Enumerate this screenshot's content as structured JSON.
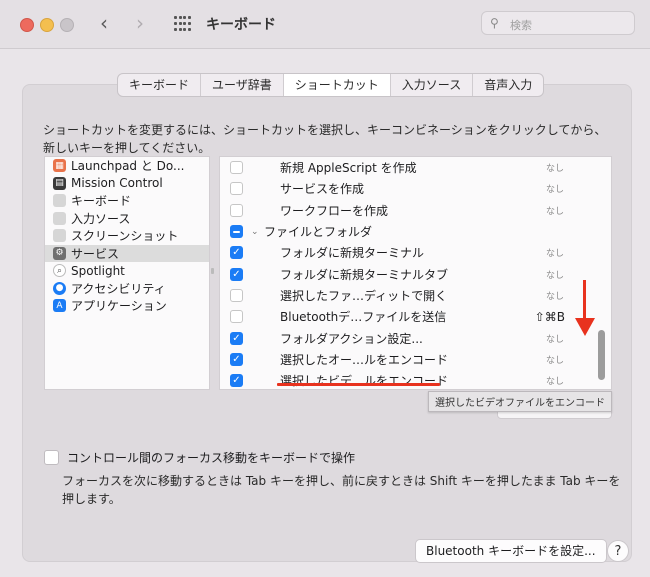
{
  "window": {
    "title": "キーボード",
    "search_placeholder": "検索"
  },
  "tabs": [
    {
      "label": "キーボード",
      "active": false
    },
    {
      "label": "ユーザ辞書",
      "active": false
    },
    {
      "label": "ショートカット",
      "active": true
    },
    {
      "label": "入力ソース",
      "active": false
    },
    {
      "label": "音声入力",
      "active": false
    }
  ],
  "instructions": "ショートカットを変更するには、ショートカットを選択し、キーコンビネーションをクリックしてから、新しいキーを押してください。",
  "categories": [
    {
      "label": "Launchpad と Do...",
      "icon": "launchpad-icon",
      "color": "#e9734b"
    },
    {
      "label": "Mission Control",
      "icon": "mission-control-icon",
      "color": "#3a3a3a"
    },
    {
      "label": "キーボード",
      "icon": "keyboard-icon",
      "color": "#d6d6d6"
    },
    {
      "label": "入力ソース",
      "icon": "input-source-icon",
      "color": "#d6d6d6"
    },
    {
      "label": "スクリーンショット",
      "icon": "screenshot-icon",
      "color": "#d6d6d6"
    },
    {
      "label": "サービス",
      "icon": "gear-icon",
      "color": "#6f6f6f",
      "selected": true
    },
    {
      "label": "Spotlight",
      "icon": "spotlight-icon",
      "color": "#ffffff"
    },
    {
      "label": "アクセシビリティ",
      "icon": "accessibility-icon",
      "color": "#1b7cf5"
    },
    {
      "label": "アプリケーション",
      "icon": "app-store-icon",
      "color": "#1b7cf5"
    }
  ],
  "shortcuts": [
    {
      "label": "新規 AppleScript を作成",
      "state": "off",
      "key": "なし"
    },
    {
      "label": "サービスを作成",
      "state": "off",
      "key": "なし"
    },
    {
      "label": "ワークフローを作成",
      "state": "off",
      "key": "なし"
    },
    {
      "label": "ファイルとフォルダ",
      "state": "mixed",
      "key": "",
      "group": true
    },
    {
      "label": "フォルダに新規ターミナル",
      "state": "on",
      "key": "なし"
    },
    {
      "label": "フォルダに新規ターミナルタブ",
      "state": "on",
      "key": "なし"
    },
    {
      "label": "選択したファ…ディットで開く",
      "state": "off",
      "key": "なし"
    },
    {
      "label": "Bluetoothデ…ファイルを送信",
      "state": "off",
      "key": "⇧⌘B"
    },
    {
      "label": "フォルダアクション設定...",
      "state": "on",
      "key": "なし"
    },
    {
      "label": "選択したオー…ルをエンコード",
      "state": "on",
      "key": "なし"
    },
    {
      "label": "選択したビデ…ルをエンコード",
      "state": "on",
      "key": "なし"
    }
  ],
  "tooltip": "選択したビデオファイルをエンコード",
  "focus_option": {
    "label": "コントロール間のフォーカス移動をキーボードで操作",
    "description": "フォーカスを次に移動するときは Tab キーを押し、前に戻すときは Shift キーを押したまま Tab キーを押します。"
  },
  "bluetooth_button": "Bluetooth キーボードを設定...",
  "help_button": "?",
  "accent_color": "#1b7cf5",
  "annotation_color": "#e8321e"
}
